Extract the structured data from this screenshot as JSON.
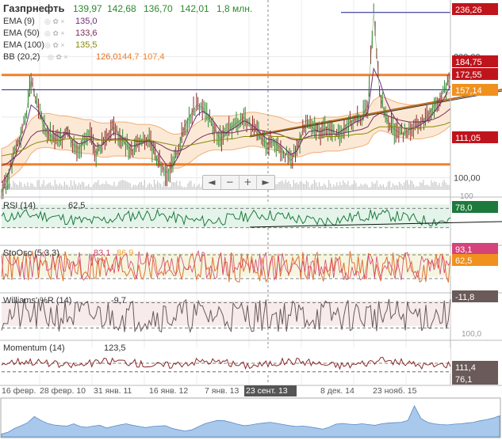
{
  "ticker": {
    "name": "Газпрнефть",
    "open": "139,97",
    "high": "142,68",
    "low": "136,70",
    "close": "142,01",
    "volume": "1,8 млн."
  },
  "indicators": [
    {
      "label": "EMA (9)",
      "value": "135,0",
      "color": "#6f2a7a"
    },
    {
      "label": "EMA (50)",
      "value": "133,6",
      "color": "#7d2a55"
    },
    {
      "label": "EMA (100)",
      "value": "135,5",
      "color": "#8a8a00"
    },
    {
      "label": "BB (20,2)",
      "value": "126,0",
      "value2": "144,7",
      "value3": "107,4",
      "color": "#e07020"
    }
  ],
  "price_axis": {
    "ticks": [
      "200,00",
      "100,00",
      "100"
    ]
  },
  "price_tags": [
    {
      "text": "236,26",
      "color": "#c0141c"
    },
    {
      "text": "184,75",
      "color": "#c0141c"
    },
    {
      "text": "172,55",
      "color": "#c0141c"
    },
    {
      "text": "157,14",
      "color": "#f0901e"
    },
    {
      "text": "111,05",
      "color": "#c0141c"
    }
  ],
  "panels": {
    "rsi": {
      "label": "RSI (14)",
      "value": "62,5",
      "tag": "78,0",
      "tag_color": "#1d7a3c"
    },
    "stoch": {
      "label": "StoOsc (5,3,3)",
      "value1": "83,1",
      "value2": "86,9",
      "tag1": "93,1",
      "tag2": "62,5",
      "tag1_color": "#d4447a",
      "tag2_color": "#f0901e"
    },
    "williams": {
      "label": "Williams' %R (14)",
      "value": "-9,7",
      "tag": "-11,8",
      "tag_color": "#6a5a5a",
      "axis_tick": "100,0"
    },
    "momentum": {
      "label": "Momentum (14)",
      "value": "123,5",
      "tag1": "111,4",
      "tag2": "76,1",
      "tag_color": "#6a5a5a"
    }
  },
  "x_axis": {
    "ticks": [
      "16 февр.",
      "28 февр. 10",
      "31 янв. 11",
      "16 янв. 12",
      "7 янв. 13",
      "23 сент. 13",
      "8 дек. 14",
      "23 нояб. 15"
    ],
    "active": "23 сент. 13"
  },
  "zoom_controls": [
    "◄",
    "−",
    "+",
    "►"
  ],
  "chart_data": {
    "type": "line",
    "title": "Газпрнефть",
    "series": [
      {
        "name": "Газпрнефть",
        "values": [
          88,
          98,
          118,
          132,
          148,
          180,
          160,
          144,
          136,
          132,
          130,
          142,
          128,
          124,
          130,
          134,
          120,
          128,
          136,
          142,
          134,
          128,
          122,
          128,
          130,
          132,
          118,
          110,
          104,
          110,
          126,
          142,
          152,
          160,
          158,
          150,
          140,
          132,
          136,
          142,
          146,
          150,
          144,
          138,
          132,
          128,
          130,
          126,
          120,
          114,
          124,
          140,
          144,
          140,
          138,
          142,
          138,
          134,
          142,
          146,
          148,
          150,
          160,
          236,
          170,
          150,
          142,
          138,
          136,
          140,
          142,
          146,
          150,
          158,
          164,
          172,
          184
        ]
      },
      {
        "name": "EMA (9)",
        "values": [
          96,
          102,
          114,
          126,
          140,
          160,
          156,
          148,
          140,
          136,
          133,
          137,
          132,
          128,
          129,
          132,
          126,
          127,
          132,
          137,
          135,
          131,
          126,
          127,
          129,
          131,
          124,
          117,
          110,
          110,
          118,
          130,
          141,
          151,
          155,
          152,
          146,
          139,
          137,
          140,
          143,
          147,
          145,
          141,
          136,
          132,
          131,
          128,
          124,
          119,
          122,
          132,
          138,
          139,
          138,
          140,
          139,
          137,
          140,
          143,
          146,
          148,
          154,
          190,
          180,
          165,
          154,
          146,
          141,
          140,
          141,
          144,
          147,
          153,
          159,
          166,
          176
        ]
      },
      {
        "name": "EMA (50)",
        "values": [
          110,
          112,
          116,
          120,
          126,
          134,
          138,
          139,
          139,
          138,
          137,
          137,
          136,
          135,
          134,
          134,
          132,
          131,
          131,
          132,
          132,
          132,
          131,
          130,
          130,
          130,
          129,
          127,
          124,
          122,
          122,
          124,
          127,
          131,
          134,
          136,
          137,
          137,
          137,
          137,
          138,
          139,
          140,
          140,
          139,
          138,
          137,
          136,
          134,
          132,
          131,
          132,
          134,
          135,
          135,
          136,
          136,
          136,
          137,
          138,
          139,
          140,
          142,
          150,
          153,
          152,
          150,
          148,
          147,
          146,
          146,
          146,
          147,
          148,
          150,
          153,
          157
        ]
      },
      {
        "name": "EMA (100)",
        "values": [
          118,
          119,
          120,
          122,
          124,
          127,
          129,
          130,
          131,
          131,
          131,
          132,
          132,
          132,
          132,
          132,
          131,
          131,
          131,
          131,
          131,
          131,
          131,
          131,
          131,
          131,
          130,
          129,
          128,
          127,
          126,
          126,
          127,
          128,
          129,
          130,
          131,
          131,
          132,
          132,
          133,
          134,
          134,
          135,
          135,
          135,
          134,
          134,
          134,
          133,
          132,
          132,
          133,
          133,
          133,
          134,
          134,
          134,
          135,
          135,
          136,
          136,
          137,
          140,
          142,
          142,
          142,
          142,
          141,
          141,
          141,
          141,
          142,
          142,
          143,
          144,
          146
        ]
      }
    ],
    "ylim": [
      90,
      240
    ],
    "hlines": [
      236.26,
      184.75,
      172.55,
      111.05
    ],
    "grid": true
  }
}
